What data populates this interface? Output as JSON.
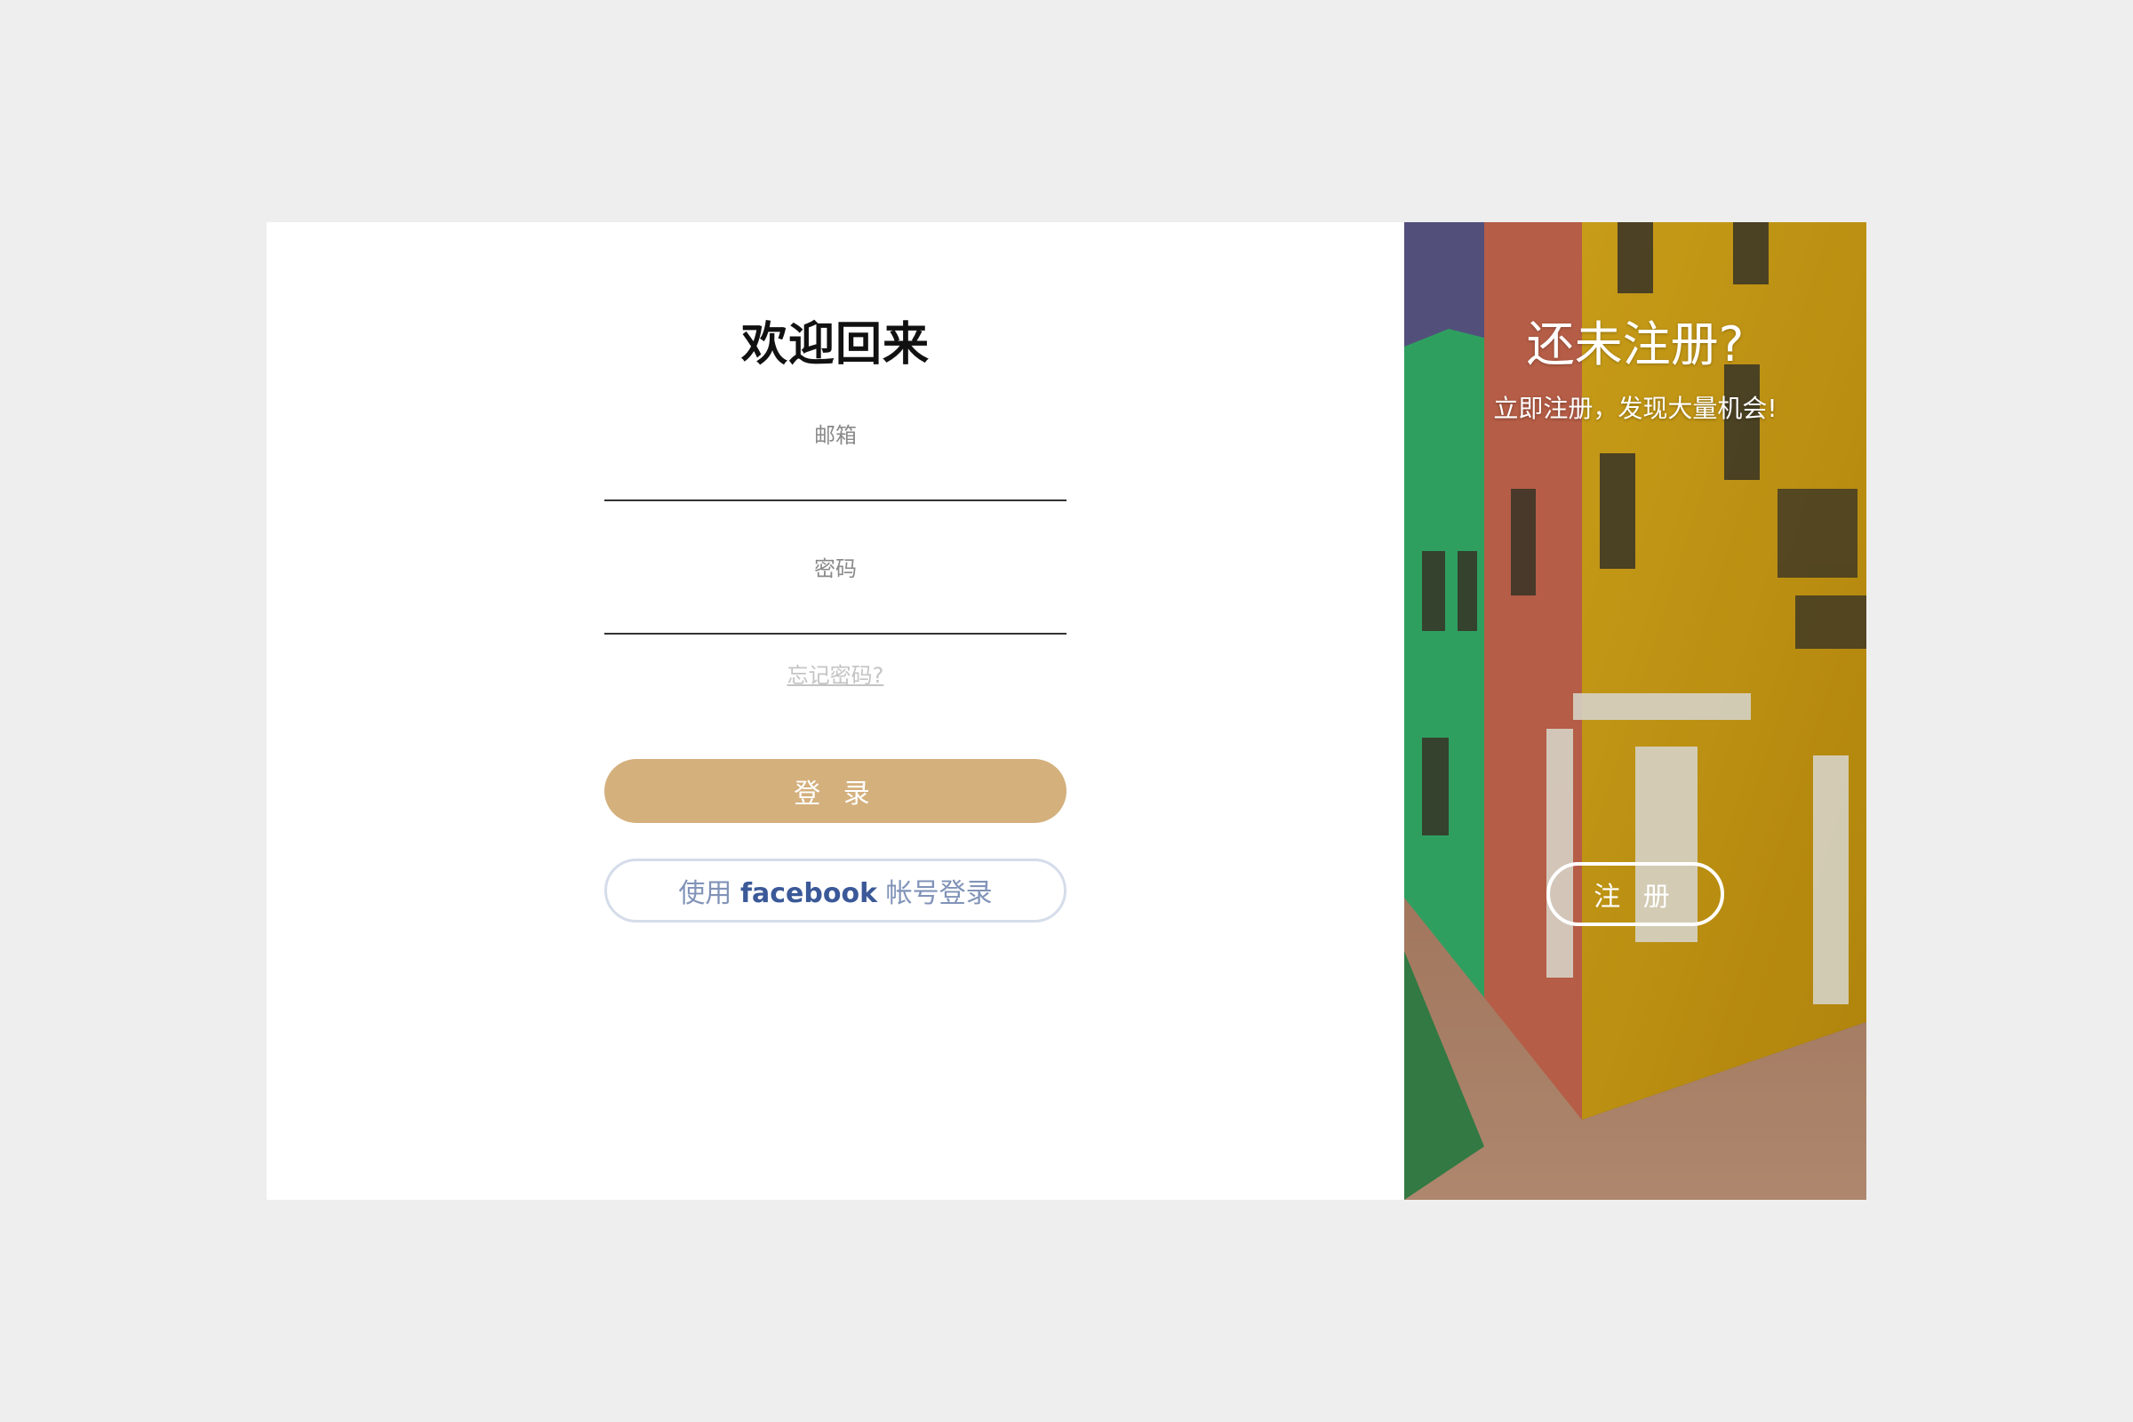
{
  "login": {
    "title": "欢迎回来",
    "email_label": "邮箱",
    "email_value": "",
    "password_label": "密码",
    "password_value": "",
    "forgot_link": "忘记密码?",
    "login_button": "登 录",
    "facebook_prefix": "使用 ",
    "facebook_brand": "facebook",
    "facebook_suffix": " 帐号登录"
  },
  "promo": {
    "title": "还未注册?",
    "subtitle": "立即注册，发现大量机会!",
    "register_button": "注 册",
    "background_image": "colorful-street-houses"
  },
  "colors": {
    "page_bg": "#eeeeee",
    "accent": "#d4b07d",
    "facebook_blue": "#3b5998",
    "facebook_text": "#8193b8",
    "facebook_border": "#d5dcea"
  }
}
